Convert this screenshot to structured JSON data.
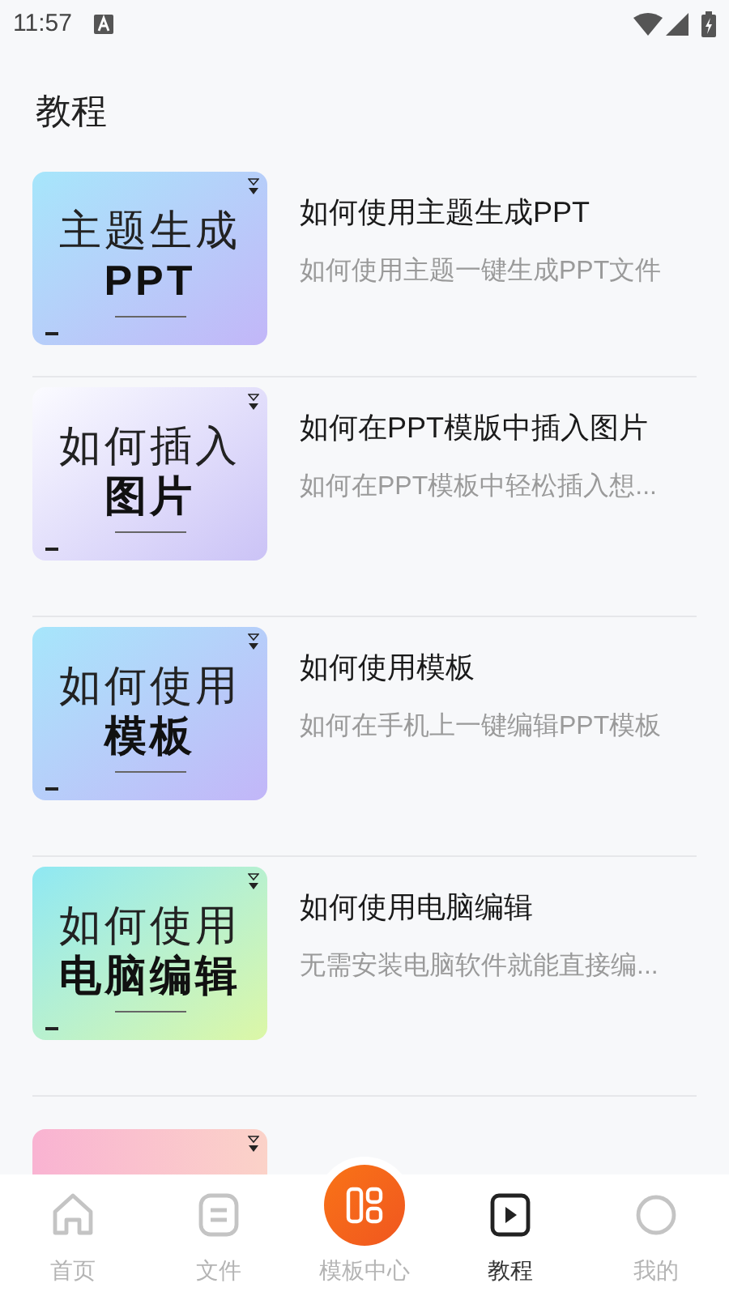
{
  "status_bar": {
    "time": "11:57"
  },
  "header": {
    "title": "教程"
  },
  "tutorials": [
    {
      "kind": "sky",
      "cover_line_1": "主题生成",
      "cover_line_2": "PPT",
      "title": "如何使用主题生成PPT",
      "subtitle": "如何使用主题一键生成PPT文件"
    },
    {
      "kind": "lavender",
      "cover_line_1": "如何插入",
      "cover_line_2": "图片",
      "title": "如何在PPT模版中插入图片",
      "subtitle": "如何在PPT模板中轻松插入想..."
    },
    {
      "kind": "sky",
      "cover_line_1": "如何使用",
      "cover_line_2": "模板",
      "title": "如何使用模板",
      "subtitle": "如何在手机上一键编辑PPT模板"
    },
    {
      "kind": "mint",
      "cover_line_1": "如何使用",
      "cover_line_2": "电脑编辑",
      "title": "如何使用电脑编辑",
      "subtitle": "无需安装电脑软件就能直接编..."
    },
    {
      "kind": "pink"
    }
  ],
  "nav": [
    {
      "kind": "home",
      "label": "首页",
      "selected": false
    },
    {
      "kind": "file",
      "label": "文件",
      "selected": false
    },
    {
      "kind": "center",
      "label": "模板中心",
      "selected": false
    },
    {
      "kind": "book",
      "label": "教程",
      "selected": true
    },
    {
      "kind": "user",
      "label": "我的",
      "selected": false
    }
  ]
}
